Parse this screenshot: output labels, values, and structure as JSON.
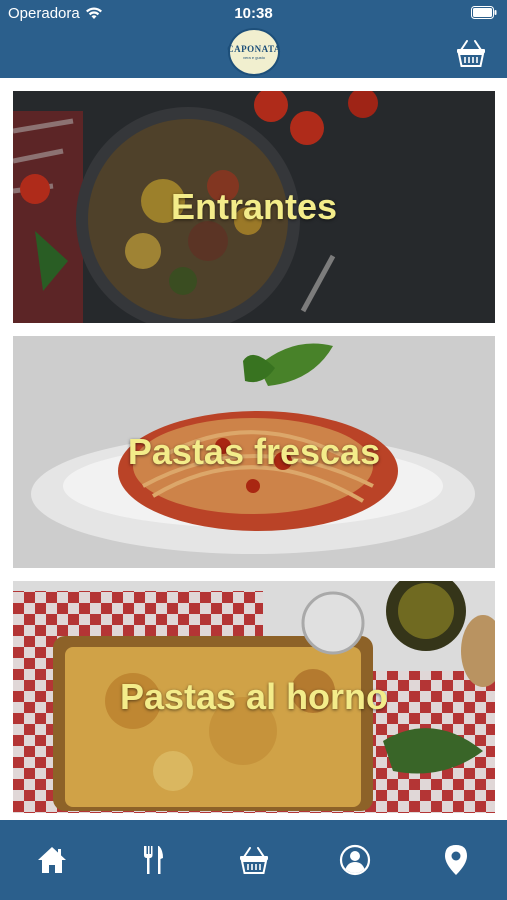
{
  "status_bar": {
    "carrier": "Operadora",
    "time": "10:38"
  },
  "header": {
    "logo_text": "CAPONATA",
    "logo_subtext": "vera e gusto",
    "cart_icon": "basket-icon"
  },
  "categories": [
    {
      "title": "Entrantes",
      "image": "caponata-dish-photo"
    },
    {
      "title": "Pastas frescas",
      "image": "spaghetti-plate-photo"
    },
    {
      "title": "Pastas al horno",
      "image": "lasagna-tray-photo"
    }
  ],
  "tab_bar": {
    "items": [
      {
        "icon": "home-icon",
        "active": true
      },
      {
        "icon": "fork-knife-icon",
        "active": false
      },
      {
        "icon": "basket-icon",
        "active": false
      },
      {
        "icon": "user-icon",
        "active": false
      },
      {
        "icon": "location-pin-icon",
        "active": false
      }
    ]
  },
  "colors": {
    "primary": "#2b5f8c",
    "title_text": "#f3ec8a"
  }
}
